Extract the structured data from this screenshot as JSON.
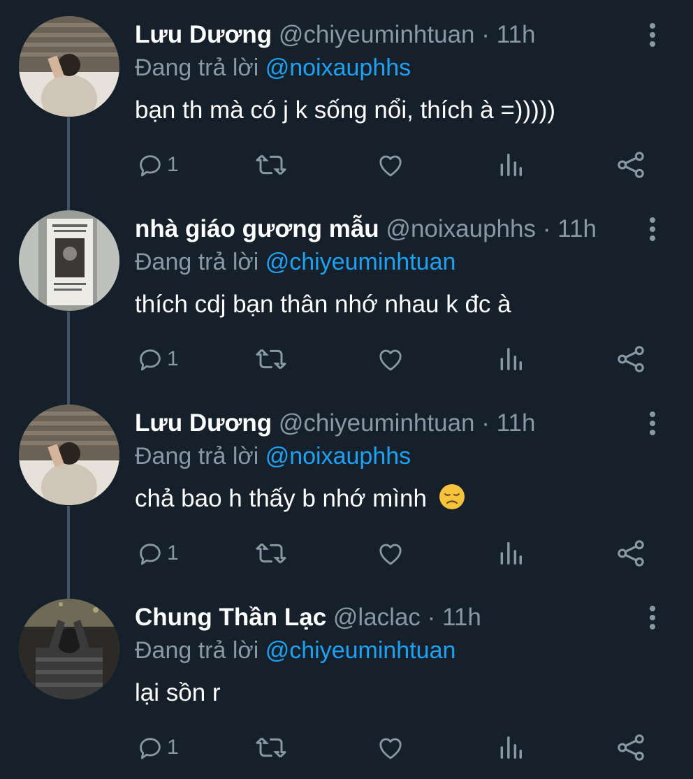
{
  "colors": {
    "background": "#15202b",
    "secondary_text": "#8899a6",
    "mention": "#1da1f2",
    "thread_line": "#3d5466"
  },
  "tweets": [
    {
      "name": "Lưu Dương",
      "handle": "@chiyeuminhtuan",
      "separator": "·",
      "time": "11h",
      "reply_label": "Đang trả lời",
      "reply_to": "@noixauphhs",
      "text": "bạn th mà có j k sống nổi, thích à =)))))",
      "reply_count": "1",
      "avatar": "man-sitting-photo"
    },
    {
      "name": "nhà giáo gương mẫu",
      "handle": "@noixauphhs",
      "separator": "·",
      "time": "11h",
      "reply_label": "Đang trả lời",
      "reply_to": "@chiyeuminhtuan",
      "text": "thích cdj bạn thân nhớ nhau k đc à",
      "reply_count": "1",
      "avatar": "poster-on-wall-photo"
    },
    {
      "name": "Lưu Dương",
      "handle": "@chiyeuminhtuan",
      "separator": "·",
      "time": "11h",
      "reply_label": "Đang trả lời",
      "reply_to": "@noixauphhs",
      "text": "chả bao h thấy b nhớ mình",
      "emoji": "disappointed-face",
      "reply_count": "1",
      "avatar": "man-sitting-photo"
    },
    {
      "name": "Chung Thần Lạc",
      "handle": "@laclac",
      "separator": "·",
      "time": "11h",
      "reply_label": "Đang trả lời",
      "reply_to": "@chiyeuminhtuan",
      "text": "lại sồn r",
      "reply_count": "1",
      "avatar": "person-hands-on-head-photo"
    }
  ]
}
